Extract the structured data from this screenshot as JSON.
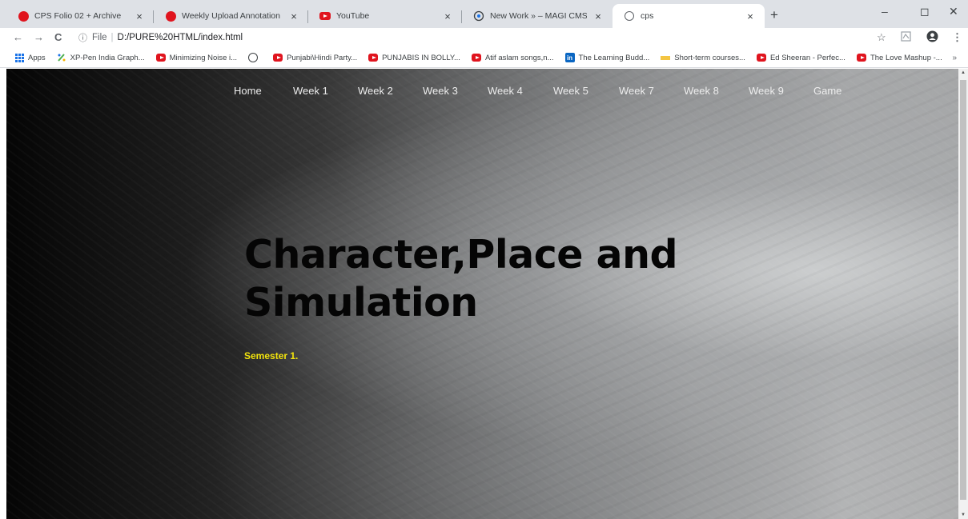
{
  "browser": {
    "tabs": [
      {
        "title": "CPS Folio 02 + Archive",
        "icon": "red-dot-icon",
        "active": false
      },
      {
        "title": "Weekly Upload Annotation Guid",
        "icon": "red-dot-icon",
        "active": false
      },
      {
        "title": "YouTube",
        "icon": "youtube-icon",
        "active": false
      },
      {
        "title": "New Work » – MAGI CMS",
        "icon": "magi-icon",
        "active": false
      },
      {
        "title": "cps",
        "icon": "globe-icon",
        "active": true
      }
    ],
    "close_glyph": "×",
    "new_tab_glyph": "+",
    "window_controls": {
      "minimize": "–",
      "maximize": "◻",
      "close": "✕"
    },
    "address": {
      "scheme_label": "File",
      "url": "D:/PURE%20HTML/index.html"
    },
    "nav_glyphs": {
      "back": "←",
      "forward": "→",
      "reload": "C"
    },
    "toolbar_glyphs": {
      "star": "☆",
      "menu": "⋮"
    },
    "bookmarks": [
      {
        "label": "Apps",
        "icon": "apps-grid-icon"
      },
      {
        "label": "XP-Pen India Graph...",
        "icon": "xp-pen-icon"
      },
      {
        "label": "Minimizing Noise i...",
        "icon": "youtube-icon"
      },
      {
        "label": "",
        "icon": "globe-icon"
      },
      {
        "label": "Punjabi\\Hindi Party...",
        "icon": "youtube-icon"
      },
      {
        "label": "PUNJABIS IN BOLLY...",
        "icon": "youtube-icon"
      },
      {
        "label": "Atif aslam songs,n...",
        "icon": "youtube-icon"
      },
      {
        "label": "The Learning Budd...",
        "icon": "linkedin-icon"
      },
      {
        "label": "Short-term courses...",
        "icon": "folder-icon"
      },
      {
        "label": "Ed Sheeran - Perfec...",
        "icon": "youtube-icon"
      },
      {
        "label": "The Love Mashup -...",
        "icon": "youtube-icon"
      }
    ],
    "bookmarks_more": "»",
    "linkedin_text": "in"
  },
  "page": {
    "nav": [
      "Home",
      "Week 1",
      "Week 2",
      "Week 3",
      "Week 4",
      "Week 5",
      "Week 7",
      "Week 8",
      "Week 9",
      "Game"
    ],
    "hero_title_line1": "Character,Place and",
    "hero_title_line2": "Simulation",
    "hero_subtitle": "Semester 1."
  },
  "colors": {
    "accent_subtitle": "#f2e30c",
    "title": "#050505",
    "tab_strip": "#dee1e6",
    "favicon_red": "#e0141e"
  }
}
